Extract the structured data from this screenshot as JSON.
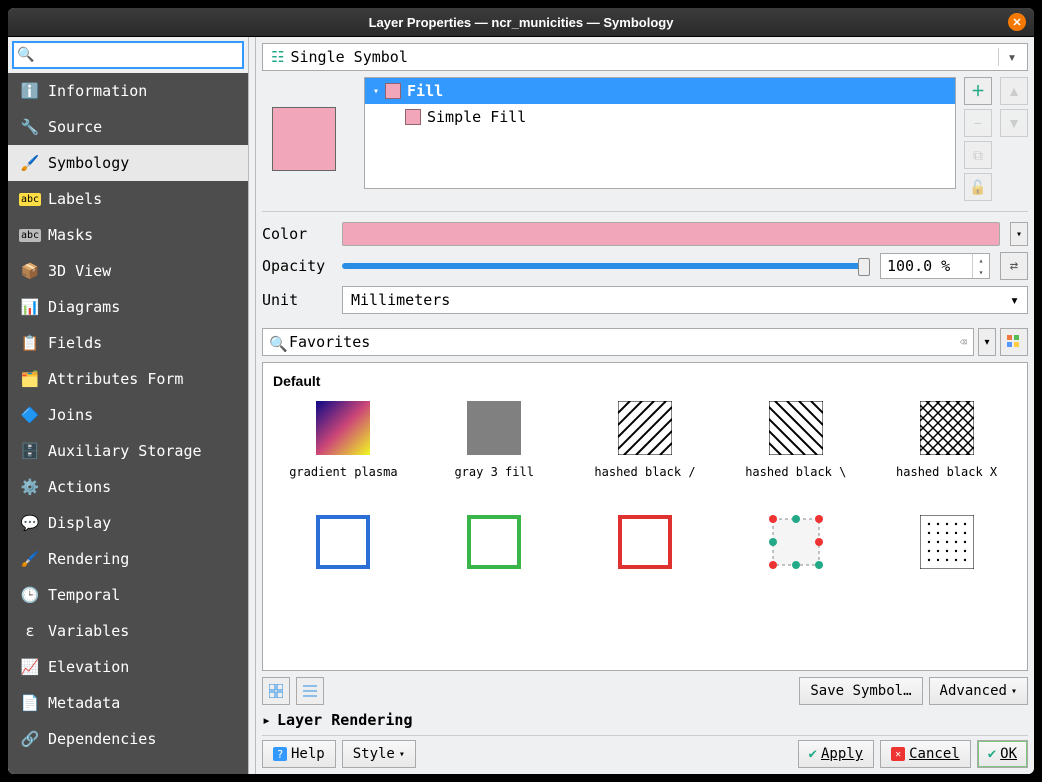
{
  "title": "Layer Properties — ncr_municities — Symbology",
  "sidebar": {
    "search": "",
    "items": [
      {
        "icon": "info",
        "label": "Information"
      },
      {
        "icon": "wrench",
        "label": "Source"
      },
      {
        "icon": "brush",
        "label": "Symbology"
      },
      {
        "icon": "abc-y",
        "label": "Labels"
      },
      {
        "icon": "abc-g",
        "label": "Masks"
      },
      {
        "icon": "cube",
        "label": "3D View"
      },
      {
        "icon": "chart",
        "label": "Diagrams"
      },
      {
        "icon": "fields",
        "label": "Fields"
      },
      {
        "icon": "form",
        "label": "Attributes Form"
      },
      {
        "icon": "join",
        "label": "Joins"
      },
      {
        "icon": "db",
        "label": "Auxiliary Storage"
      },
      {
        "icon": "gear",
        "label": "Actions"
      },
      {
        "icon": "tip",
        "label": "Display"
      },
      {
        "icon": "render",
        "label": "Rendering"
      },
      {
        "icon": "clock",
        "label": "Temporal"
      },
      {
        "icon": "var",
        "label": "Variables"
      },
      {
        "icon": "elev",
        "label": "Elevation"
      },
      {
        "icon": "meta",
        "label": "Metadata"
      },
      {
        "icon": "dep",
        "label": "Dependencies"
      }
    ]
  },
  "symbology": {
    "type": "Single Symbol",
    "tree": {
      "root": "Fill",
      "child": "Simple Fill"
    },
    "color_label": "Color",
    "opacity_label": "Opacity",
    "opacity_value": "100.0 %",
    "unit_label": "Unit",
    "unit_value": "Millimeters",
    "tags_value": "Favorites",
    "group_title": "Default",
    "swatches": [
      "gradient plasma",
      "gray 3 fill",
      "hashed black /",
      "hashed black \\",
      "hashed black X",
      "",
      "",
      "",
      "",
      ""
    ],
    "save_symbol": "Save Symbol…",
    "advanced": "Advanced",
    "layer_rendering": "Layer Rendering"
  },
  "buttons": {
    "help": "Help",
    "style": "Style",
    "apply": "Apply",
    "cancel": "Cancel",
    "ok": "OK"
  }
}
